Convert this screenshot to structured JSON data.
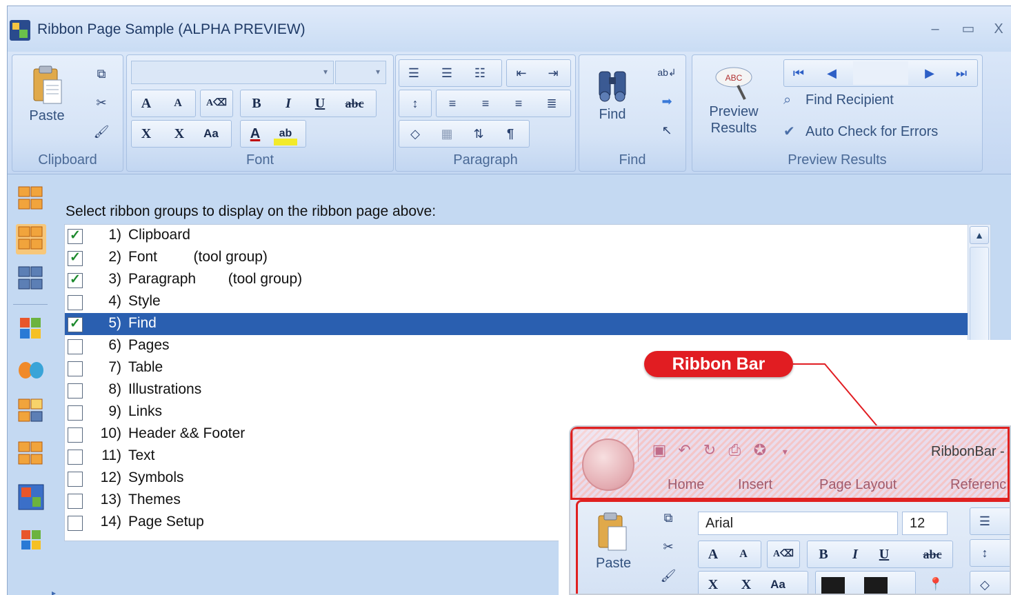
{
  "window": {
    "title": "Ribbon Page Sample (ALPHA PREVIEW)",
    "minimize": "–",
    "maximize": "▭",
    "close": "X"
  },
  "ribbon": {
    "groups": {
      "clipboard": {
        "label": "Clipboard",
        "paste": "Paste"
      },
      "font": {
        "label": "Font",
        "bold": "B",
        "italic": "I",
        "underline": "U",
        "strike": "abc",
        "grow": "A",
        "shrink": "A",
        "subscript": "X",
        "superscript": "X",
        "case": "Aa",
        "color_a": "A",
        "highlight": "ab"
      },
      "paragraph": {
        "label": "Paragraph",
        "pilcrow": "¶"
      },
      "find": {
        "label": "Find",
        "find": "Find"
      },
      "preview": {
        "label": "Preview Results",
        "preview_line1": "Preview",
        "preview_line2": "Results",
        "find_recipient": "Find Recipient",
        "auto_check": "Auto Check for Errors"
      }
    }
  },
  "content": {
    "instruction": "Select ribbon groups to display on the ribbon page above:",
    "items": [
      {
        "num": "1)",
        "label": "Clipboard",
        "checked": true,
        "selected": false
      },
      {
        "num": "2)",
        "label": "Font         (tool group)",
        "checked": true,
        "selected": false
      },
      {
        "num": "3)",
        "label": "Paragraph        (tool group)",
        "checked": true,
        "selected": false
      },
      {
        "num": "4)",
        "label": "Style",
        "checked": false,
        "selected": false
      },
      {
        "num": "5)",
        "label": "Find",
        "checked": true,
        "selected": true
      },
      {
        "num": "6)",
        "label": "Pages",
        "checked": false,
        "selected": false
      },
      {
        "num": "7)",
        "label": "Table",
        "checked": false,
        "selected": false
      },
      {
        "num": "8)",
        "label": "Illustrations",
        "checked": false,
        "selected": false
      },
      {
        "num": "9)",
        "label": "Links",
        "checked": false,
        "selected": false
      },
      {
        "num": "10)",
        "label": "Header && Footer",
        "checked": false,
        "selected": false
      },
      {
        "num": "11)",
        "label": "Text",
        "checked": false,
        "selected": false
      },
      {
        "num": "12)",
        "label": "Symbols",
        "checked": false,
        "selected": false
      },
      {
        "num": "13)",
        "label": "Themes",
        "checked": false,
        "selected": false
      },
      {
        "num": "14)",
        "label": "Page Setup",
        "checked": false,
        "selected": false
      }
    ]
  },
  "callout": {
    "label": "Ribbon Bar",
    "color": "#e11d22"
  },
  "preview": {
    "title": "RibbonBar -",
    "tabs": [
      "Home",
      "Insert",
      "Page Layout",
      "Referenc"
    ],
    "font_name": "Arial",
    "font_size": "12",
    "paste": "Paste"
  },
  "colors": {
    "selection": "#2a5fb0",
    "ribbon_text": "#33527f"
  }
}
